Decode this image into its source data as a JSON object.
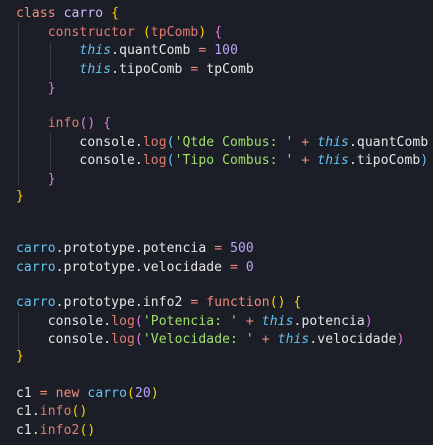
{
  "colors": {
    "background": "#1b1e26",
    "keyword": "#f28b7d",
    "class_name": "#cdb8ff",
    "method": "#e27b72",
    "number": "#b9a4f8",
    "this": "#65c3f2",
    "string": "#9fe06a",
    "bracket": "#ffd000",
    "text": "#e6e6e6"
  },
  "code": {
    "line1": {
      "kw": "class",
      "name": "carro",
      "brace": "{"
    },
    "line2": {
      "name": "constructor",
      "open": "(",
      "param": "tpComb",
      "close": ")",
      "brace": "{"
    },
    "line3": {
      "this": "this",
      "prop": ".quantComb",
      "op": "=",
      "num": "100"
    },
    "line4": {
      "this": "this",
      "prop": ".tipoComb",
      "op": "=",
      "val": "tpComb"
    },
    "line5": {
      "brace": "}"
    },
    "line6": {
      "name": "info",
      "parens": "()",
      "brace": "{"
    },
    "line7": {
      "obj": "console.",
      "fn": "log",
      "open": "(",
      "str": "'Qtde Combus: '",
      "op": "+",
      "this": "this",
      "prop": ".quantComb"
    },
    "line8": {
      "obj": "console.",
      "fn": "log",
      "open": "(",
      "str": "'Tipo Combus: '",
      "op": "+",
      "this": "this",
      "prop": ".tipoComb",
      "close": ")"
    },
    "line9": {
      "brace": "}"
    },
    "line10": {
      "brace": "}"
    },
    "line11": {
      "obj": "carro",
      "rest": ".prototype.potencia",
      "op": "=",
      "num": "500"
    },
    "line12": {
      "obj": "carro",
      "rest": ".prototype.velocidade",
      "op": "=",
      "num": "0"
    },
    "line13": {
      "obj": "carro",
      "rest": ".prototype.info2",
      "op": "=",
      "kw": "function",
      "parens": "()",
      "brace": "{"
    },
    "line14": {
      "obj": "console.",
      "fn": "log",
      "open": "(",
      "str": "'Potencia: '",
      "op": "+",
      "this": "this",
      "prop": ".potencia",
      "close": ")"
    },
    "line15": {
      "obj": "console.",
      "fn": "log",
      "open": "(",
      "str": "'Velocidade: '",
      "op": "+",
      "this": "this",
      "prop": ".velocidade",
      "close": ")"
    },
    "line16": {
      "brace": "}"
    },
    "line17": {
      "var": "c1",
      "op": "=",
      "kw": "new",
      "name": "carro",
      "open": "(",
      "num": "20",
      "close": ")"
    },
    "line18": {
      "var": "c1",
      "dot": ".",
      "fn": "info",
      "parens": "()"
    },
    "line19": {
      "var": "c1",
      "dot": ".",
      "fn": "info2",
      "parens": "()"
    }
  }
}
